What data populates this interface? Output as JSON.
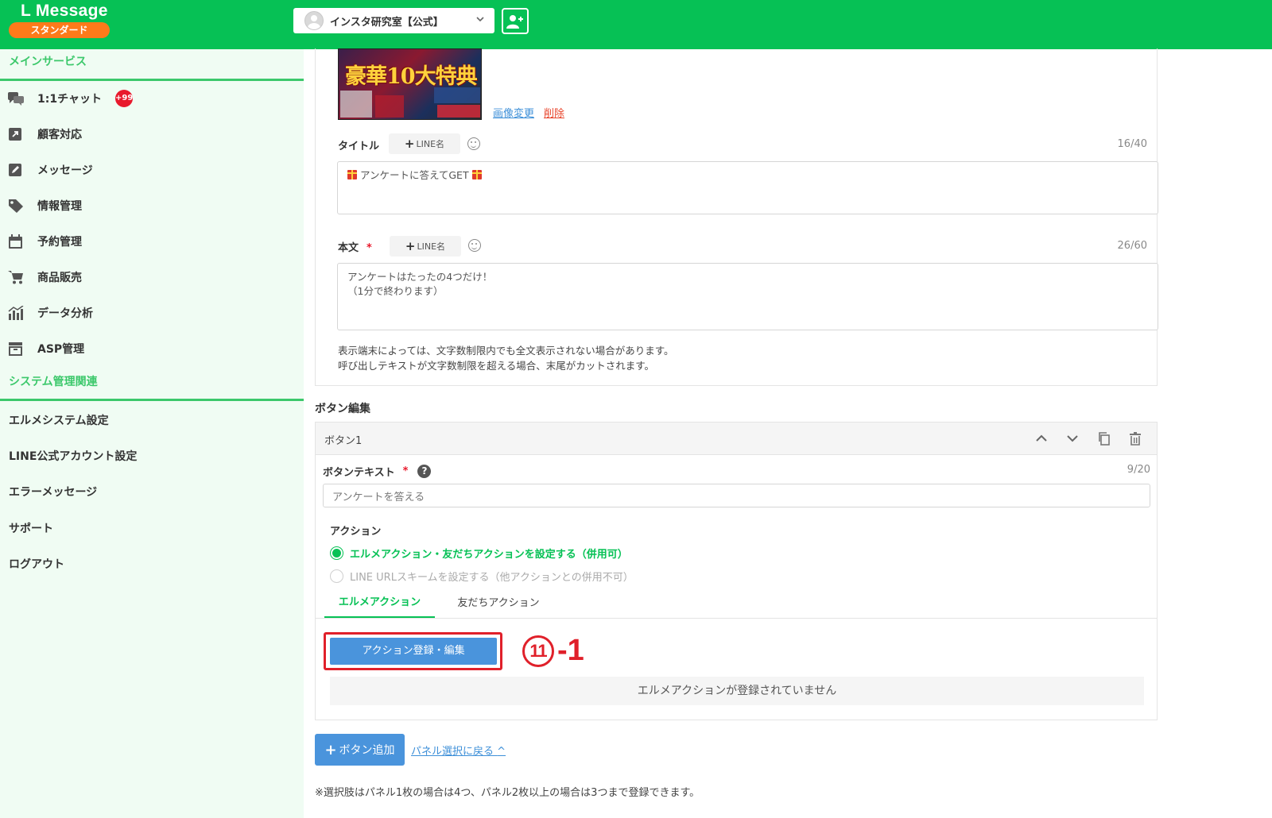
{
  "header": {
    "logo": "L Message",
    "plan": "スタンダード",
    "account_name": "インスタ研究室【公式】"
  },
  "sidebar": {
    "main_section": "メインサービス",
    "main_items": [
      {
        "label": "1:1チャット",
        "icon": "chat-icon",
        "badge": "+99"
      },
      {
        "label": "顧客対応",
        "icon": "external-link-icon"
      },
      {
        "label": "メッセージ",
        "icon": "edit-message-icon"
      },
      {
        "label": "情報管理",
        "icon": "tag-icon"
      },
      {
        "label": "予約管理",
        "icon": "calendar-icon"
      },
      {
        "label": "商品販売",
        "icon": "cart-icon"
      },
      {
        "label": "データ分析",
        "icon": "bar-chart-icon"
      },
      {
        "label": "ASP管理",
        "icon": "archive-icon"
      }
    ],
    "system_section": "システム管理関連",
    "system_items": [
      {
        "label": "エルメシステム設定"
      },
      {
        "label": "LINE公式アカウント設定"
      },
      {
        "label": "エラーメッセージ"
      },
      {
        "label": "サポート"
      },
      {
        "label": "ログアウト"
      }
    ]
  },
  "panel": {
    "image_text": "豪華10大特典",
    "change_image": "画像変更",
    "delete": "削除",
    "title_label": "タイトル",
    "line_name_btn": "LINE名",
    "title_counter": "16/40",
    "title_value": "アンケートに答えてGET",
    "body_label": "本文",
    "required_mark": "*",
    "body_counter": "26/60",
    "body_value": "アンケートはたったの4つだけ！\n（1分で終わります）",
    "note_line1": "表示端末によっては、文字数制限内でも全文表示されない場合があります。",
    "note_line2": "呼び出しテキストが文字数制限を超える場合、末尾がカットされます。"
  },
  "button_edit": {
    "section_title": "ボタン編集",
    "card_title": "ボタン1",
    "text_label": "ボタンテキスト",
    "text_counter": "9/20",
    "text_value": "アンケートを答える",
    "action_label": "アクション",
    "radio_option1": "エルメアクション・友だちアクションを設定する（併用可）",
    "radio_option2": "LINE URLスキームを設定する（他アクションとの併用不可）",
    "tab_elme": "エルメアクション",
    "tab_friend": "友だちアクション",
    "register_btn": "アクション登録・編集",
    "step_number": "11",
    "step_suffix": "-1",
    "empty_message": "エルメアクションが登録されていません"
  },
  "footer": {
    "add_button": "ボタン追加",
    "back_link": "パネル選択に戻る",
    "bottom_note": "※選択肢はパネル1枚の場合は4つ、パネル2枚以上の場合は3つまで登録できます。"
  },
  "colors": {
    "brand_green": "#06c155",
    "accent_orange": "#ff7a1a",
    "primary_blue": "#4a94dc",
    "alert_red": "#e0202a"
  }
}
